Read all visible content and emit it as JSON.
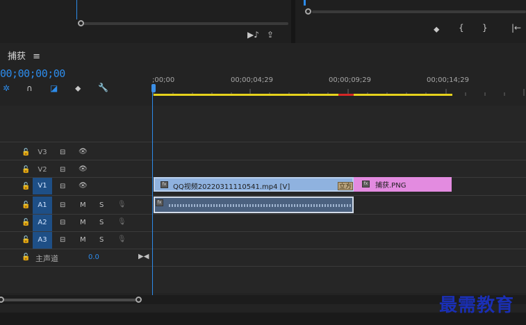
{
  "panel": {
    "title": "捕获",
    "menu_icon": "≡"
  },
  "timecode": "00;00;00;00",
  "ruler": {
    "labels": [
      ";00;00",
      "00;00;04;29",
      "00;00;09;29",
      "00;00;14;29"
    ]
  },
  "tracks": {
    "v3": {
      "name": "V3"
    },
    "v2": {
      "name": "V2"
    },
    "v1": {
      "name": "V1"
    },
    "a1": {
      "name": "A1",
      "m": "M",
      "s": "S"
    },
    "a2": {
      "name": "A2",
      "m": "M",
      "s": "S"
    },
    "a3": {
      "name": "A3",
      "m": "M",
      "s": "S"
    },
    "master": {
      "name": "主声道",
      "value": "0.0"
    }
  },
  "clips": {
    "video": {
      "label": "QQ视频20220311110541.mp4 [V]",
      "fx": "fx"
    },
    "transition": {
      "label": "立方"
    },
    "image": {
      "label": "捕获.PNG",
      "fx": "fx"
    },
    "audio": {
      "fx": "fx"
    }
  },
  "watermark": "最需教育",
  "colors": {
    "accent": "#2d8ceb",
    "video_clip": "#8fb2df",
    "image_clip": "#e38be0",
    "audio_clip": "#4b617f",
    "work_area": "#e6d21c"
  }
}
